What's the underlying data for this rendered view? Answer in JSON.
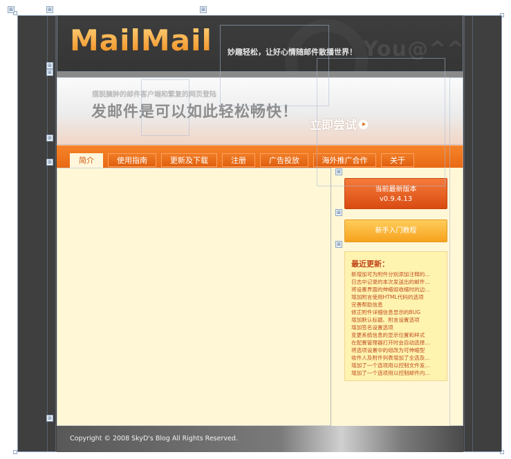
{
  "header": {
    "logo": "MailMail",
    "slogan": "妙趣轻松，让好心情随邮件散播世界！",
    "watermark": "You@^^"
  },
  "banner": {
    "subtitle": "摆脱臃肿的邮件客户端和繁复的网页登陆",
    "title": "发邮件是可以如此轻松畅快！",
    "cta": "立即尝试"
  },
  "nav": {
    "tabs": [
      "简介",
      "使用指南",
      "更新及下载",
      "注册",
      "广告投放",
      "海外推广合作",
      "关于"
    ],
    "active": "简介"
  },
  "sidebar": {
    "latest_line1": "当前最新版本",
    "latest_line2": "v0.9.4.13",
    "tutorial": "新手入门教程",
    "updates_title": "最近更新：",
    "updates": [
      "新增加可为附件分别添加注释的...",
      "日志中记录的本次发送出的邮件...",
      "将设置界面的伸缩组收缩时的边...",
      "增加附言使用HTML代码的选项",
      "完善帮助信息",
      "修正附件详细信息显示的BUG",
      "增加默认标题、附言设置选项",
      "增加签名设置选项",
      "变更系统信息的显示位置和样式",
      "在配置管理器打开时会自动选择...",
      "将选项设置中的组改为可伸缩型",
      "收件人及附件列表增加了全选及...",
      "增加了一个选项用以控制文件发...",
      "增加了一个选项用以控制邮件内..."
    ]
  },
  "footer": {
    "copyright": "Copyright © 2008 SkyD's Blog All Rights Reserved."
  },
  "colors": {
    "accent": "#f5832a",
    "content_bg": "#fff7d6",
    "frame": "#3f3f3f"
  }
}
